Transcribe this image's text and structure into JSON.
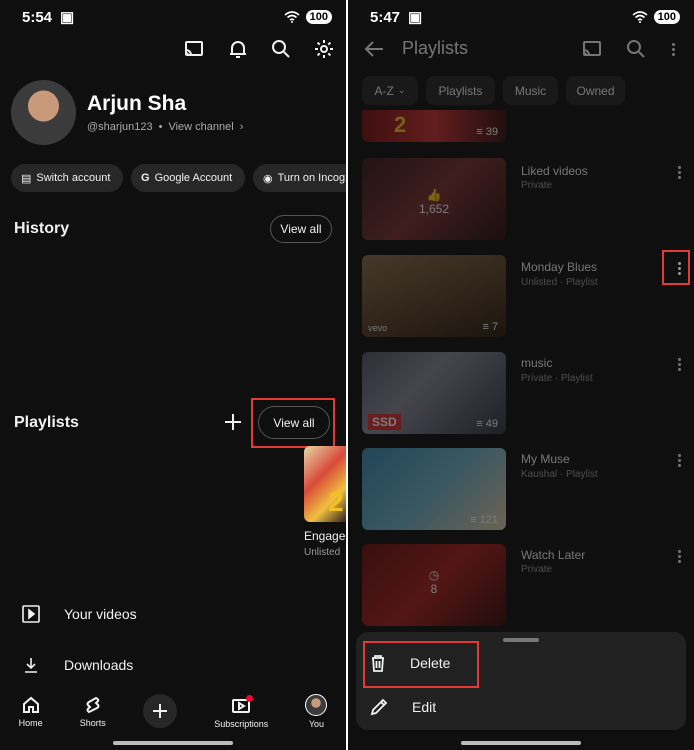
{
  "left": {
    "status": {
      "time": "5:54",
      "battery": "100"
    },
    "profile": {
      "name": "Arjun Sha",
      "handle": "@sharjun123",
      "separator": "•",
      "view_channel": "View channel"
    },
    "chips": [
      "Switch account",
      "Google Account",
      "Turn on Incog"
    ],
    "history": {
      "title": "History",
      "view_all": "View all"
    },
    "playlists": {
      "title": "Playlists",
      "view_all": "View all",
      "preview_title": "Engage",
      "preview_sub": "Unlisted"
    },
    "menu": {
      "your_videos": "Your videos",
      "downloads": "Downloads"
    },
    "nav": {
      "home": "Home",
      "shorts": "Shorts",
      "subscriptions": "Subscriptions",
      "you": "You"
    }
  },
  "right": {
    "status": {
      "time": "5:47",
      "battery": "100"
    },
    "header": {
      "title": "Playlists"
    },
    "filters": {
      "sort": "A-Z",
      "items": [
        "Playlists",
        "Music",
        "Owned"
      ]
    },
    "top_partial": {
      "count": "39"
    },
    "playlists": [
      {
        "title": "Liked videos",
        "sub": "Private",
        "count": "1,652"
      },
      {
        "title": "Monday Blues",
        "sub": "Unlisted · Playlist",
        "count": "7"
      },
      {
        "title": "music",
        "sub": "Private · Playlist",
        "count": "49"
      },
      {
        "title": "My Muse",
        "sub": "Kaushal · Playlist",
        "count": "121"
      },
      {
        "title": "Watch Later",
        "sub": "Private",
        "count": "8"
      }
    ],
    "sheet": {
      "delete": "Delete",
      "edit": "Edit"
    },
    "accent": "#e53935"
  }
}
